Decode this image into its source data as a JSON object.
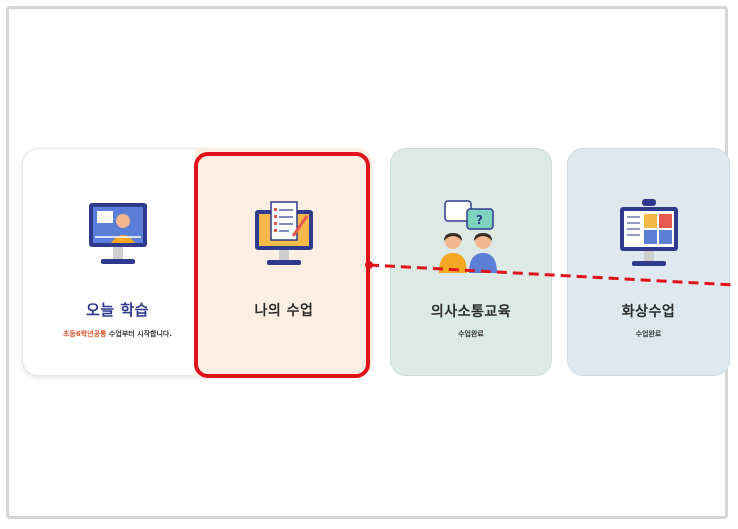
{
  "cards": [
    {
      "title": "오늘 학습",
      "sub_highlight": "초등6학년공통",
      "sub_rest": " 수업부터 시작합니다."
    },
    {
      "title": "나의 수업"
    },
    {
      "title": "의사소통교육",
      "sub": "수업완료"
    },
    {
      "title": "화상수업",
      "sub": "수업완료"
    }
  ],
  "icons": [
    "teacher-monitor-icon",
    "checklist-monitor-icon",
    "conversation-people-icon",
    "video-conference-icon"
  ],
  "colors": {
    "highlight": "#e0131a",
    "accent_orange": "#d9542b",
    "title_blue": "#2f3a8f"
  }
}
